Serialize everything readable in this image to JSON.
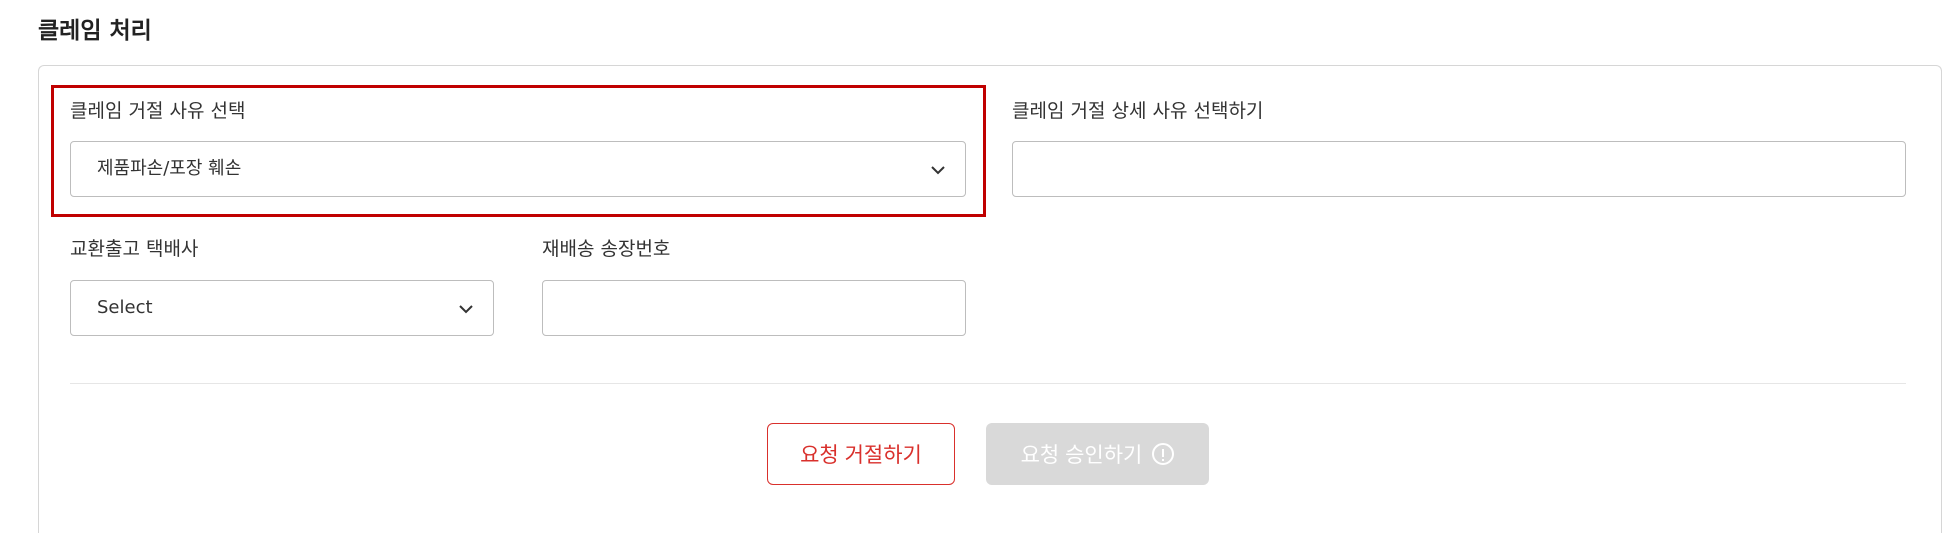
{
  "section": {
    "title": "클레임 처리"
  },
  "form": {
    "reject_reason": {
      "label": "클레임 거절 사유 선택",
      "selected": "제품파손/포장 훼손"
    },
    "reject_detail": {
      "label": "클레임 거절 상세 사유 선택하기",
      "value": ""
    },
    "courier": {
      "label": "교환출고 택배사",
      "selected": "Select"
    },
    "tracking": {
      "label": "재배송 송장번호",
      "value": ""
    }
  },
  "actions": {
    "reject_label": "요청 거절하기",
    "approve_label": "요청 승인하기"
  },
  "colors": {
    "accent_red": "#d9302c",
    "highlight_red": "#c00000",
    "disabled_gray": "#d9d9d9"
  }
}
